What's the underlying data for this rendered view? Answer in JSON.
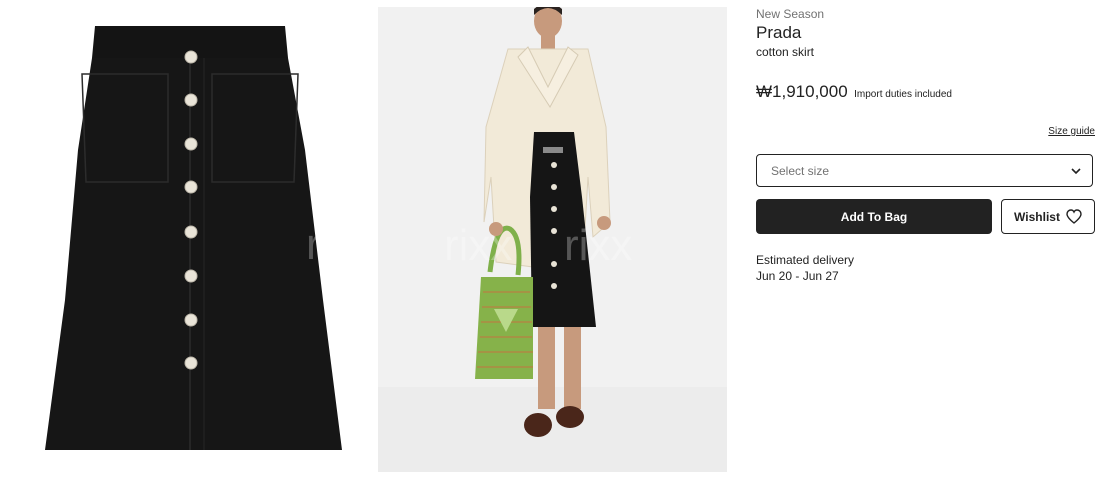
{
  "product": {
    "label": "New Season",
    "brand": "Prada",
    "name": "cotton skirt",
    "price": "₩1,910,000",
    "duties": "Import duties included"
  },
  "size": {
    "guide_label": "Size guide",
    "select_placeholder": "Select size"
  },
  "actions": {
    "add_to_bag": "Add To Bag",
    "wishlist": "Wishlist"
  },
  "delivery": {
    "label": "Estimated delivery",
    "dates": "Jun 20 - Jun 27"
  },
  "gallery": {
    "watermark": "rixx"
  },
  "colors": {
    "primary": "#222222",
    "muted": "#727272"
  },
  "icons": [
    "chevron-down-icon",
    "heart-icon"
  ]
}
